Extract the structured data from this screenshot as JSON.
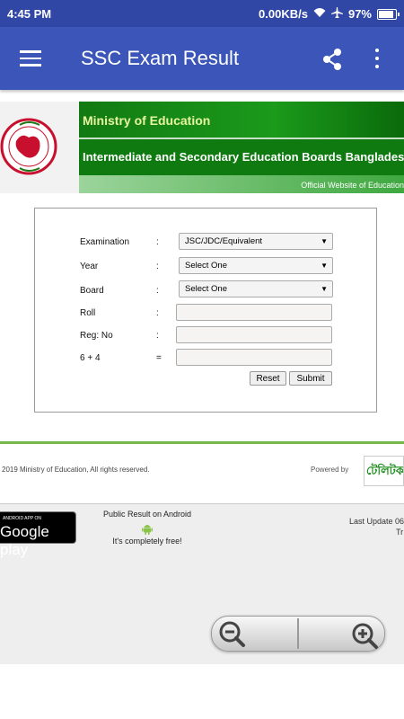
{
  "status_bar": {
    "time": "4:45 PM",
    "net_speed": "0.00KB/s",
    "battery": "97%"
  },
  "app_bar": {
    "title": "SSC Exam Result"
  },
  "banner": {
    "ministry": "Ministry of Education",
    "boards": "Intermediate and Secondary Education Boards Bangladesh",
    "official": "Official Website of Education"
  },
  "form": {
    "fields": [
      {
        "label": "Examination",
        "sep": ":",
        "value": "JSC/JDC/Equivalent"
      },
      {
        "label": "Year",
        "sep": ":",
        "value": "Select One"
      },
      {
        "label": "Board",
        "sep": ":",
        "value": "Select One"
      },
      {
        "label": "Roll",
        "sep": ":",
        "value": ""
      },
      {
        "label": "Reg: No",
        "sep": ":",
        "value": ""
      },
      {
        "label": "6 + 4",
        "sep": "=",
        "value": ""
      }
    ],
    "reset_label": "Reset",
    "submit_label": "Submit"
  },
  "footer": {
    "copyright": "2019 Ministry of Education, All rights reserved.",
    "powered_by": "Powered by",
    "teletalk": "টেলিটক",
    "google_play_small": "ANDROID APP ON",
    "google_play_big": "Google play",
    "public_result": "Public Result on Android",
    "free": "It's completely free!",
    "last_update": "Last Update 06",
    "last_update_2": "Tr"
  },
  "colors": {
    "app_bar": "#3b55b8",
    "status_bar": "#3047a6",
    "green": "#127a12"
  }
}
